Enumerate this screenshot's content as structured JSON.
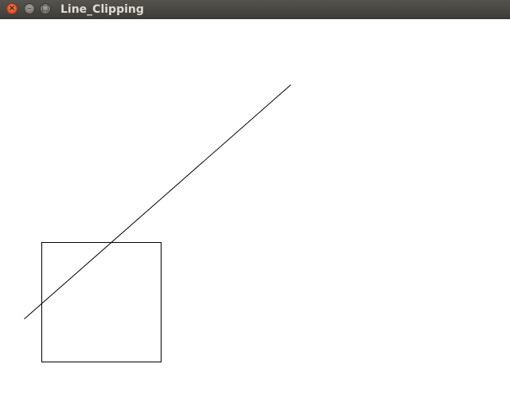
{
  "window": {
    "title": "Line_Clipping",
    "close_icon": "×",
    "minimize_icon": "–",
    "maximize_icon": "□",
    "icons": [
      "close-icon",
      "minimize-icon",
      "maximize-icon"
    ]
  },
  "colors": {
    "titlebar": "#3f3d39",
    "title_text": "#dfdbd2",
    "close_button": "#e5572a",
    "canvas_background": "#ffffff",
    "stroke": "#000000"
  }
}
